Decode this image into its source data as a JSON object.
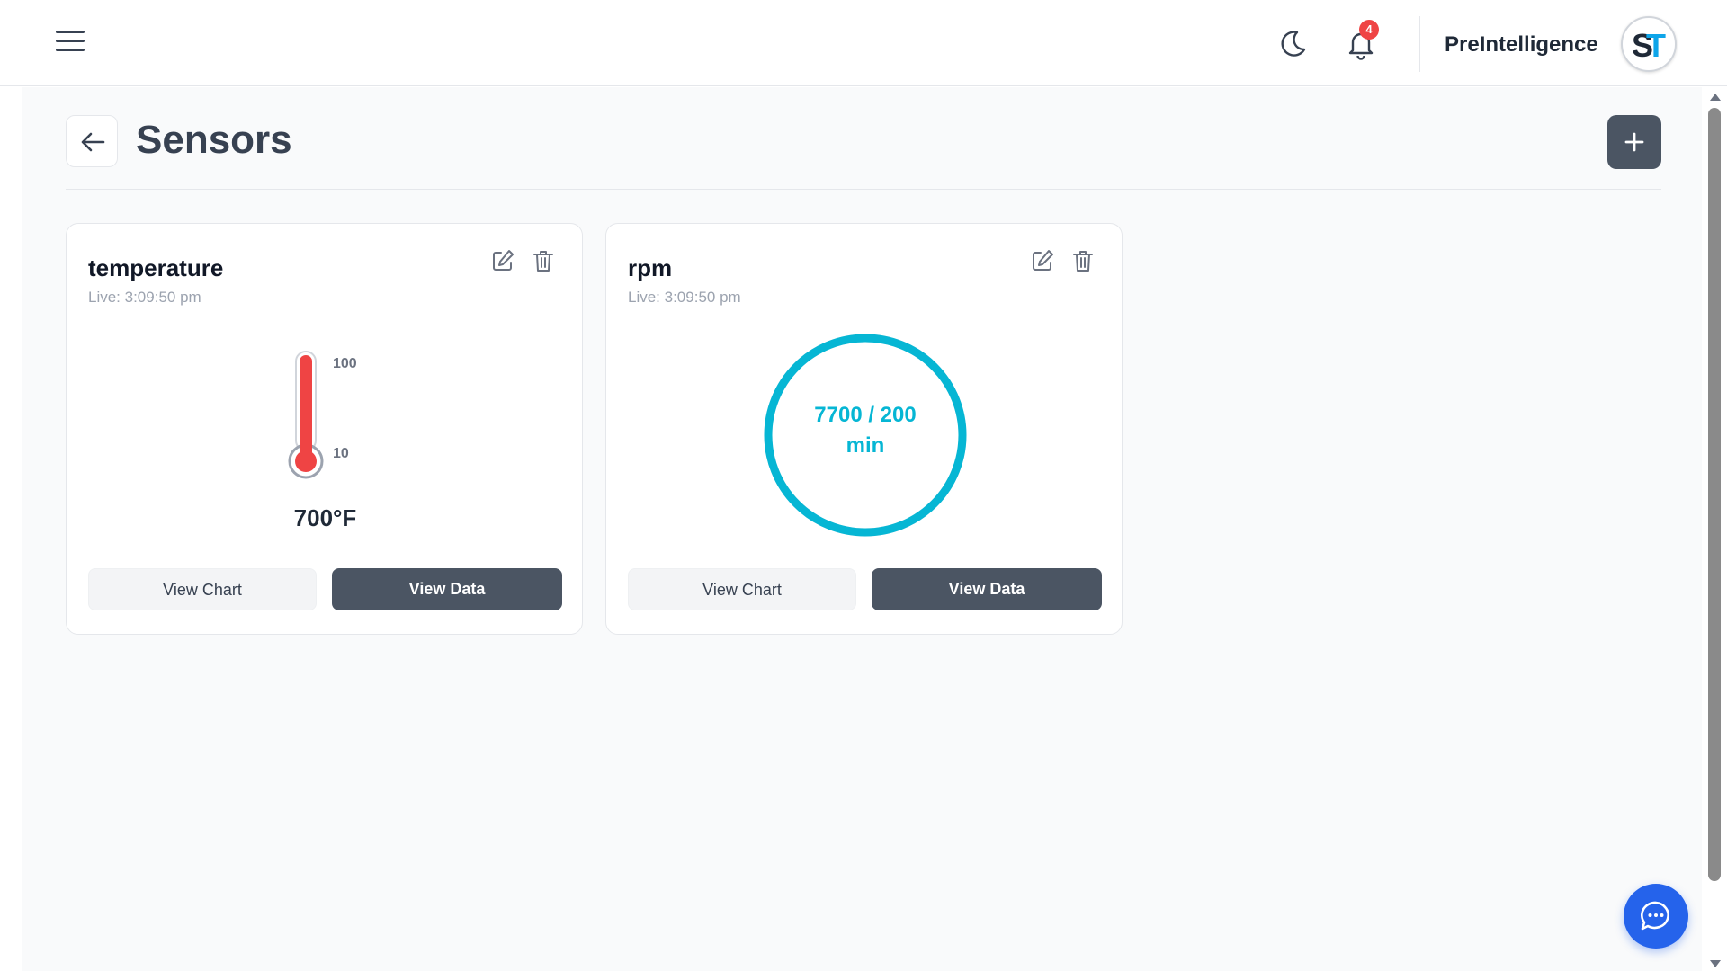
{
  "header": {
    "brand": "PreIntelligence",
    "notification_count": "4",
    "avatar_initials": "ST",
    "icons": {
      "menu": "hamburger-menu-icon",
      "theme": "moon-icon",
      "notifications": "bell-icon"
    }
  },
  "page": {
    "title": "Sensors"
  },
  "sensors": [
    {
      "name": "temperature",
      "live": "Live: 3:09:50 pm",
      "widget": "thermometer",
      "scale_max_label": "100",
      "scale_min_label": "10",
      "value_text": "700°F",
      "fill_fraction": 1.0,
      "view_chart_label": "View Chart",
      "view_data_label": "View Data"
    },
    {
      "name": "rpm",
      "live": "Live: 3:09:50 pm",
      "widget": "ring-gauge",
      "gauge_line1": "7700 / 200",
      "gauge_line2": "min",
      "fill_fraction": 1.0,
      "view_chart_label": "View Chart",
      "view_data_label": "View Data"
    }
  ],
  "colors": {
    "accent_dark": "#4b5563",
    "thermometer_red": "#ef4444",
    "gauge_cyan": "#06b6d4",
    "badge_red": "#ef4444",
    "chat_blue": "#2563eb"
  }
}
